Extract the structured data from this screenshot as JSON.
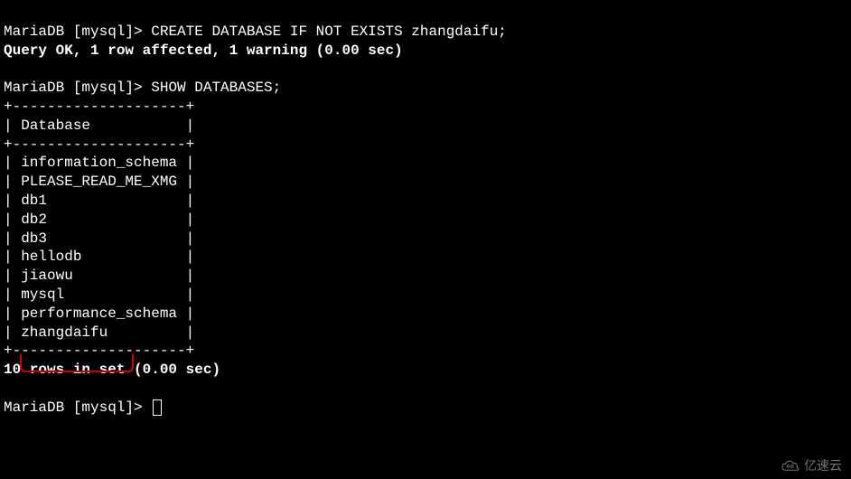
{
  "session": {
    "prompt1": "MariaDB [mysql]> ",
    "command1": "CREATE DATABASE IF NOT EXISTS zhangdaifu;",
    "result1": "Query OK, 1 row affected, 1 warning (0.00 sec)",
    "prompt2": "MariaDB [mysql]> ",
    "command2": "SHOW DATABASES;",
    "border_top": "+--------------------+",
    "header_row": "| Database           |",
    "border_mid": "+--------------------+",
    "rows": [
      "| information_schema |",
      "| PLEASE_READ_ME_XMG |",
      "| db1                |",
      "| db2                |",
      "| db3                |",
      "| hellodb            |",
      "| jiaowu             |",
      "| mysql              |",
      "| performance_schema |",
      "| zhangdaifu         |"
    ],
    "border_bot": "+--------------------+",
    "summary": "10 rows in set (0.00 sec)",
    "prompt3": "MariaDB [mysql]> "
  },
  "watermark": {
    "text": "亿速云"
  },
  "highlight": {
    "top": "392",
    "left": "22",
    "width": "126",
    "height": "20"
  }
}
